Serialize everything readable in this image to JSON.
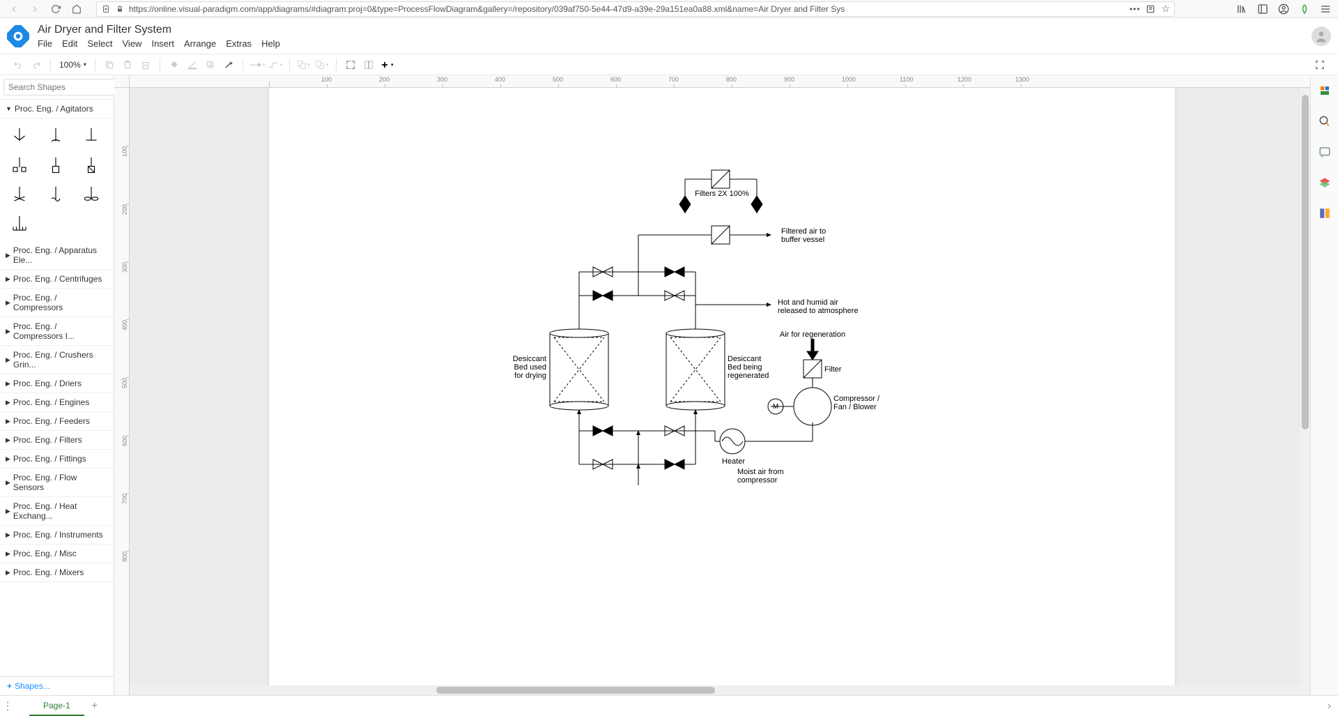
{
  "browser": {
    "url": "https://online.visual-paradigm.com/app/diagrams/#diagram:proj=0&type=ProcessFlowDiagram&gallery=/repository/039af750-5e44-47d9-a39e-29a151ea0a88.xml&name=Air Dryer and Filter Sys"
  },
  "app": {
    "title": "Air Dryer and Filter System",
    "menus": [
      "File",
      "Edit",
      "Select",
      "View",
      "Insert",
      "Arrange",
      "Extras",
      "Help"
    ]
  },
  "toolbar": {
    "zoom": "100%"
  },
  "search": {
    "placeholder": "Search Shapes"
  },
  "categories": {
    "open": "Proc. Eng. / Agitators",
    "list": [
      "Proc. Eng. / Apparatus Ele...",
      "Proc. Eng. / Centrifuges",
      "Proc. Eng. / Compressors",
      "Proc. Eng. / Compressors I...",
      "Proc. Eng. / Crushers Grin...",
      "Proc. Eng. / Driers",
      "Proc. Eng. / Engines",
      "Proc. Eng. / Feeders",
      "Proc. Eng. / Filters",
      "Proc. Eng. / Fittings",
      "Proc. Eng. / Flow Sensors",
      "Proc. Eng. / Heat Exchang...",
      "Proc. Eng. / Instruments",
      "Proc. Eng. / Misc",
      "Proc. Eng. / Mixers"
    ]
  },
  "shapesFooter": "Shapes...",
  "pageTab": "Page-1",
  "rulerH": [
    100,
    200,
    300,
    400,
    500,
    600,
    700,
    800,
    900,
    1000,
    1100,
    1200,
    1300
  ],
  "rulerV": [
    100,
    200,
    300,
    400,
    500,
    600,
    700,
    800
  ],
  "diagram": {
    "filtersLabel": "Filters 2X 100%",
    "filteredAir": "Filtered air to buffer vessel",
    "hotHumid": "Hot and humid air released to atmosphere",
    "airRegen": "Air for regeneration",
    "filter": "Filter",
    "compressor": "Compressor / Fan / Blower",
    "motor": "M",
    "heater": "Heater",
    "moistAir": "Moist air from compressor",
    "desiccant1": "Desiccant Bed used for drying",
    "desiccant2": "Desiccant Bed being regenerated"
  }
}
